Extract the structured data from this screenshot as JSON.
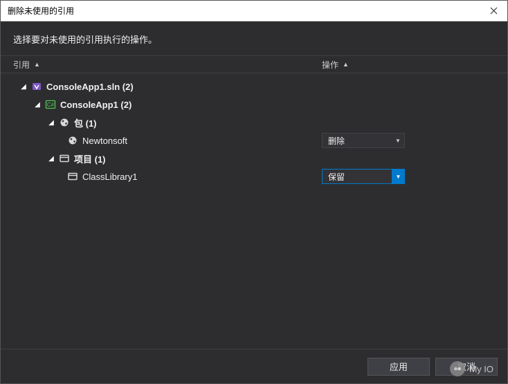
{
  "dialog": {
    "title": "删除未使用的引用",
    "subtitle": "选择要对未使用的引用执行的操作。"
  },
  "columns": {
    "reference": "引用",
    "action": "操作"
  },
  "tree": {
    "solution": "ConsoleApp1.sln  (2)",
    "project": "ConsoleApp1  (2)",
    "packages_group": "包  (1)",
    "package_item": "Newtonsoft",
    "projects_group": "项目  (1)",
    "project_item": "ClassLibrary1"
  },
  "actions": {
    "delete": "删除",
    "keep": "保留"
  },
  "footer": {
    "apply": "应用",
    "cancel": "取消"
  },
  "watermark": "My IO"
}
